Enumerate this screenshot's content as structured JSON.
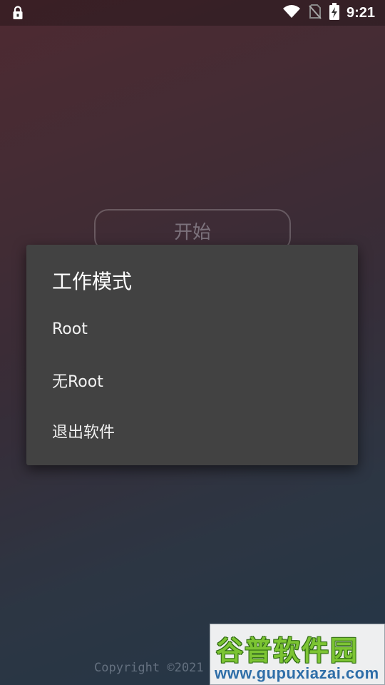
{
  "status_bar": {
    "time": "9:21",
    "icons": [
      "lock-icon",
      "wifi-icon",
      "no-sim-icon",
      "battery-charging-icon"
    ]
  },
  "main": {
    "start_label": "开始",
    "copyright": "Copyright ©2021"
  },
  "dialog": {
    "title": "工作模式",
    "items": [
      {
        "label": "Root"
      },
      {
        "label": "无Root"
      },
      {
        "label": "退出软件"
      }
    ]
  },
  "watermark": {
    "brand": "谷普软件园",
    "url": "www.gupuxiazai.com"
  }
}
